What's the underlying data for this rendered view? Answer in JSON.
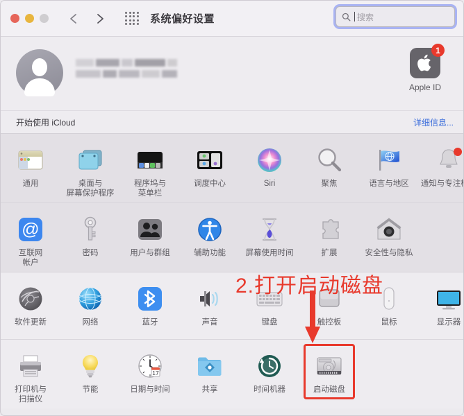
{
  "window": {
    "title": "系统偏好设置",
    "traffic_lights": [
      "close",
      "minimize",
      "zoom"
    ],
    "nav": {
      "back": "back-chevron",
      "forward": "forward-chevron",
      "grid": "show-all-grid"
    }
  },
  "search": {
    "placeholder": "搜索",
    "value": "",
    "icon": "search-icon",
    "focused": true
  },
  "apple_id": {
    "avatar": "user-avatar",
    "name_hidden": true,
    "icon_label": "Apple ID",
    "badge_count": "1"
  },
  "icloud": {
    "text": "开始使用 iCloud",
    "link": "详细信息..."
  },
  "annotation": {
    "text": "2.打开启动磁盘",
    "color": "#e8392c",
    "arrow": "down-arrow"
  },
  "bands": [
    {
      "id": "band-1",
      "items": [
        {
          "label": "通用",
          "icon": "general-icon"
        },
        {
          "label": "桌面与\n屏幕保护程序",
          "icon": "desktop-screensaver-icon"
        },
        {
          "label": "程序坞与\n菜单栏",
          "icon": "dock-menubar-icon"
        },
        {
          "label": "调度中心",
          "icon": "mission-control-icon"
        },
        {
          "label": "Siri",
          "icon": "siri-icon"
        },
        {
          "label": "聚焦",
          "icon": "spotlight-icon"
        },
        {
          "label": "语言与地区",
          "icon": "language-region-icon"
        },
        {
          "label": "通知与专注模式",
          "icon": "notifications-focus-icon"
        }
      ]
    },
    {
      "id": "band-2",
      "items": [
        {
          "label": "互联网\n帐户",
          "icon": "internet-accounts-icon"
        },
        {
          "label": "密码",
          "icon": "passwords-icon"
        },
        {
          "label": "用户与群组",
          "icon": "users-groups-icon"
        },
        {
          "label": "辅助功能",
          "icon": "accessibility-icon"
        },
        {
          "label": "屏幕使用时间",
          "icon": "screen-time-icon"
        },
        {
          "label": "扩展",
          "icon": "extensions-icon"
        },
        {
          "label": "安全性与隐私",
          "icon": "security-privacy-icon"
        }
      ]
    },
    {
      "id": "band-3",
      "items": [
        {
          "label": "软件更新",
          "icon": "software-update-icon"
        },
        {
          "label": "网络",
          "icon": "network-icon"
        },
        {
          "label": "蓝牙",
          "icon": "bluetooth-icon"
        },
        {
          "label": "声音",
          "icon": "sound-icon"
        },
        {
          "label": "键盘",
          "icon": "keyboard-icon"
        },
        {
          "label": "触控板",
          "icon": "trackpad-icon"
        },
        {
          "label": "鼠标",
          "icon": "mouse-icon"
        },
        {
          "label": "显示器",
          "icon": "displays-icon"
        }
      ]
    },
    {
      "id": "band-4",
      "items": [
        {
          "label": "打印机与\n扫描仪",
          "icon": "printers-scanners-icon"
        },
        {
          "label": "节能",
          "icon": "energy-saver-icon"
        },
        {
          "label": "日期与时间",
          "icon": "date-time-icon"
        },
        {
          "label": "共享",
          "icon": "sharing-icon"
        },
        {
          "label": "时间机器",
          "icon": "time-machine-icon"
        },
        {
          "label": "启动磁盘",
          "icon": "startup-disk-icon",
          "highlighted": true
        }
      ]
    }
  ]
}
